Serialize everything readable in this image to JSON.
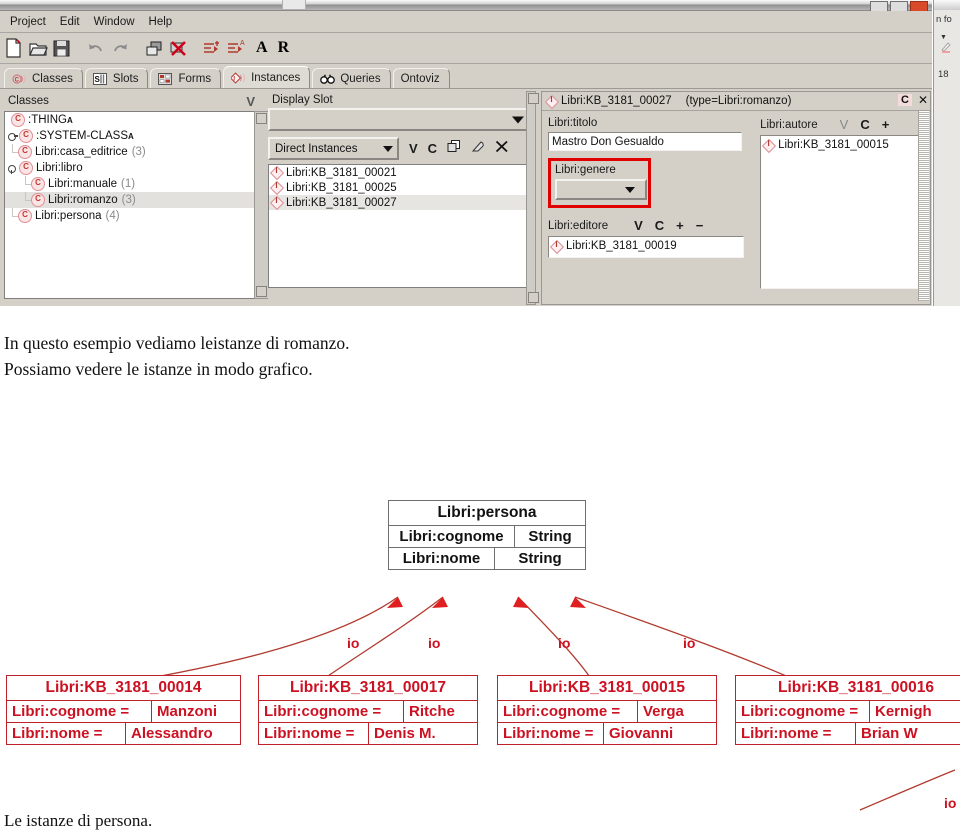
{
  "app": {
    "menu": [
      "Project",
      "Edit",
      "Window",
      "Help"
    ],
    "toolbar_icons": [
      "new-project-icon",
      "open-project-icon",
      "save-project-icon",
      "undo-icon",
      "redo-icon",
      "copy-icon",
      "delete-icon",
      "indent-icon",
      "sort-icon"
    ],
    "toolbar_letters": [
      "A",
      "R"
    ],
    "tabs": [
      {
        "label": "Classes",
        "icon": "classes-icon",
        "active": false
      },
      {
        "label": "Slots",
        "icon": "slots-icon",
        "active": false
      },
      {
        "label": "Forms",
        "icon": "forms-icon",
        "active": false
      },
      {
        "label": "Instances",
        "icon": "instances-icon",
        "active": true
      },
      {
        "label": "Queries",
        "icon": "queries-icon",
        "active": false
      },
      {
        "label": "Ontoviz",
        "icon": "ontoviz-icon",
        "active": false
      }
    ]
  },
  "classes_panel": {
    "title": "Classes",
    "header_button": "V",
    "tree": [
      {
        "label": ":THING",
        "sup": "A",
        "count": "",
        "level": 0,
        "knob": "none",
        "selected": false
      },
      {
        "label": ":SYSTEM-CLASS",
        "sup": "A",
        "count": "",
        "level": 0,
        "knob": "closed",
        "selected": false
      },
      {
        "label": "Libri:casa_editrice",
        "sup": "",
        "count": "(3)",
        "level": 0,
        "knob": "elbow",
        "selected": false
      },
      {
        "label": "Libri:libro",
        "sup": "",
        "count": "",
        "level": 0,
        "knob": "open",
        "selected": false
      },
      {
        "label": "Libri:manuale",
        "sup": "",
        "count": "(1)",
        "level": 1,
        "knob": "elbow",
        "selected": false
      },
      {
        "label": "Libri:romanzo",
        "sup": "",
        "count": "(3)",
        "level": 1,
        "knob": "elbow",
        "selected": true
      },
      {
        "label": "Libri:persona",
        "sup": "",
        "count": "(4)",
        "level": 0,
        "knob": "elbow",
        "selected": false
      }
    ]
  },
  "instances_panel": {
    "display_slot_label": "Display Slot",
    "display_slot_value": "",
    "direct_instances_label": "Direct Instances",
    "tools": [
      "V",
      "C",
      "copy-icon",
      "paste-icon",
      "delete-icon"
    ],
    "instances": [
      {
        "label": "Libri:KB_3181_00021",
        "selected": false
      },
      {
        "label": "Libri:KB_3181_00025",
        "selected": false
      },
      {
        "label": "Libri:KB_3181_00027",
        "selected": true
      }
    ]
  },
  "editor_panel": {
    "title": "Libri:KB_3181_00027",
    "type_text": "(type=Libri:romanzo)",
    "corner_c": "C",
    "corner_x": "✕",
    "titolo_label": "Libri:titolo",
    "titolo_value": "Mastro Don Gesualdo",
    "genere_label": "Libri:genere",
    "genere_value": "",
    "genere_highlight_color": "#e00000",
    "editore_label": "Libri:editore",
    "editore_ops": [
      "V",
      "C",
      "+",
      "−"
    ],
    "editore_values": [
      "Libri:KB_3181_00019"
    ],
    "autore_label": "Libri:autore",
    "autore_ops": [
      "V",
      "C",
      "+"
    ],
    "autore_values": [
      "Libri:KB_3181_00015"
    ]
  },
  "sliver_window": {
    "line1": "n fo",
    "line2": "18"
  },
  "text": {
    "paragraph_line1": "In questo esempio vediamo leistanze di romanzo.",
    "paragraph_line2": "Possiamo vedere le istanze in modo grafico.",
    "caption": "Le istanze di persona."
  },
  "diagram": {
    "class_box": {
      "title": "Libri:persona",
      "rows": [
        {
          "name": "Libri:cognome",
          "type": "String"
        },
        {
          "name": "Libri:nome",
          "type": "String"
        }
      ]
    },
    "edge_label": "io",
    "edge_labels": [
      "io",
      "io",
      "io",
      "io",
      "io"
    ],
    "instances": [
      {
        "title": "Libri:KB_3181_00014",
        "rows": [
          {
            "name": "Libri:cognome =",
            "value": "Manzoni"
          },
          {
            "name": "Libri:nome =",
            "value": "Alessandro"
          }
        ]
      },
      {
        "title": "Libri:KB_3181_00017",
        "rows": [
          {
            "name": "Libri:cognome =",
            "value": "Ritche"
          },
          {
            "name": "Libri:nome =",
            "value": "Denis M."
          }
        ]
      },
      {
        "title": "Libri:KB_3181_00015",
        "rows": [
          {
            "name": "Libri:cognome =",
            "value": "Verga"
          },
          {
            "name": "Libri:nome =",
            "value": "Giovanni"
          }
        ]
      },
      {
        "title": "Libri:KB_3181_00016",
        "rows": [
          {
            "name": "Libri:cognome =",
            "value": "Kernigh"
          },
          {
            "name": "Libri:nome =",
            "value": "Brian W"
          }
        ]
      }
    ]
  }
}
